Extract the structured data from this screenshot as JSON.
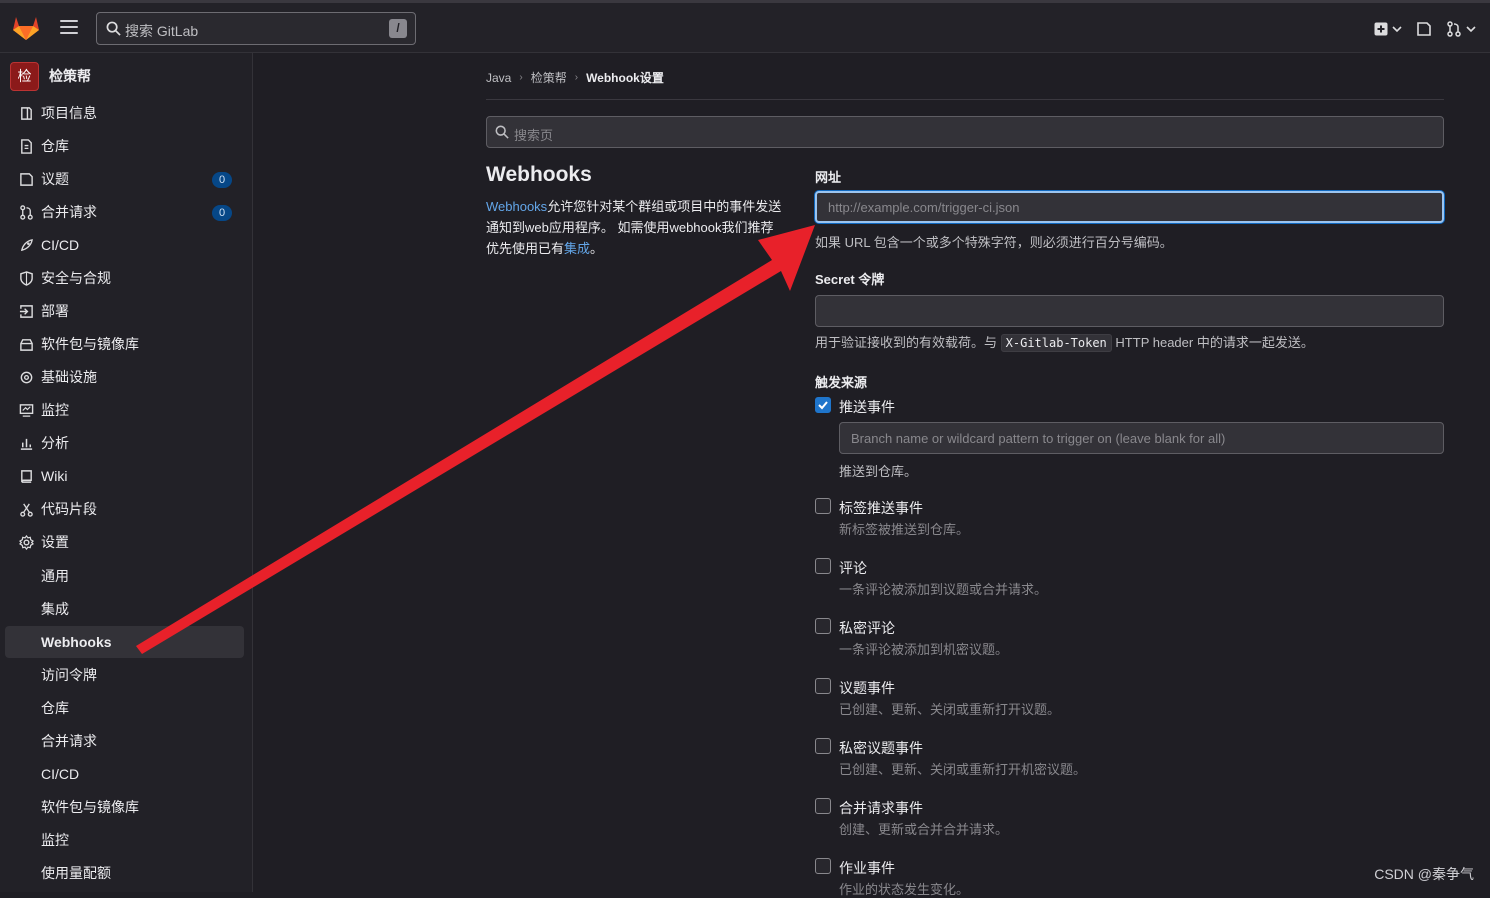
{
  "topbar": {
    "search_placeholder": "搜索 GitLab",
    "search_shortcut": "/"
  },
  "sidebar": {
    "project_avatar": "检",
    "project_name": "检策帮",
    "items": [
      {
        "label": "项目信息",
        "icon": "project-info-icon"
      },
      {
        "label": "仓库",
        "icon": "repository-icon"
      },
      {
        "label": "议题",
        "icon": "issues-icon",
        "badge": "0"
      },
      {
        "label": "合并请求",
        "icon": "merge-request-icon",
        "badge": "0"
      },
      {
        "label": "CI/CD",
        "icon": "rocket-icon"
      },
      {
        "label": "安全与合规",
        "icon": "shield-icon"
      },
      {
        "label": "部署",
        "icon": "deployments-icon"
      },
      {
        "label": "软件包与镜像库",
        "icon": "package-icon"
      },
      {
        "label": "基础设施",
        "icon": "cloud-gear-icon"
      },
      {
        "label": "监控",
        "icon": "monitor-icon"
      },
      {
        "label": "分析",
        "icon": "chart-icon"
      },
      {
        "label": "Wiki",
        "icon": "book-icon"
      },
      {
        "label": "代码片段",
        "icon": "snippet-icon"
      },
      {
        "label": "设置",
        "icon": "settings-icon"
      }
    ],
    "settings_sub": [
      "通用",
      "集成",
      "Webhooks",
      "访问令牌",
      "仓库",
      "合并请求",
      "CI/CD",
      "软件包与镜像库",
      "监控",
      "使用量配额"
    ],
    "active_sub": "Webhooks"
  },
  "breadcrumb": {
    "items": [
      "Java",
      "检策帮",
      "Webhook设置"
    ]
  },
  "page_search_placeholder": "搜索页",
  "intro": {
    "title": "Webhooks",
    "link": "Webhooks",
    "text1": "允许您针对某个群组或项目中的事件发送通知到web应用程序。 如需使用webhook我们推荐优先使用已有",
    "link2": "集成",
    "text2": "。"
  },
  "form": {
    "url_label": "网址",
    "url_placeholder": "http://example.com/trigger-ci.json",
    "url_help": "如果 URL 包含一个或多个特殊字符，则必须进行百分号编码。",
    "secret_label": "Secret 令牌",
    "secret_help_prefix": "用于验证接收到的有效载荷。与",
    "secret_help_code": "X-Gitlab-Token",
    "secret_help_suffix": "HTTP header 中的请求一起发送。",
    "triggers_label": "触发来源",
    "push_label": "推送事件",
    "push_checked": true,
    "branch_placeholder": "Branch name or wildcard pattern to trigger on (leave blank for all)",
    "push_help": "推送到仓库。",
    "triggers": [
      {
        "label": "标签推送事件",
        "desc": "新标签被推送到仓库。"
      },
      {
        "label": "评论",
        "desc": "一条评论被添加到议题或合并请求。"
      },
      {
        "label": "私密评论",
        "desc": "一条评论被添加到机密议题。"
      },
      {
        "label": "议题事件",
        "desc": "已创建、更新、关闭或重新打开议题。"
      },
      {
        "label": "私密议题事件",
        "desc": "已创建、更新、关闭或重新打开机密议题。"
      },
      {
        "label": "合并请求事件",
        "desc": "创建、更新或合并合并请求。"
      },
      {
        "label": "作业事件",
        "desc": "作业的状态发生变化。"
      }
    ]
  },
  "watermark": "CSDN @秦争气",
  "colors": {
    "accent": "#1f75cb",
    "arrow": "#e8212a",
    "link": "#63a6e9"
  }
}
